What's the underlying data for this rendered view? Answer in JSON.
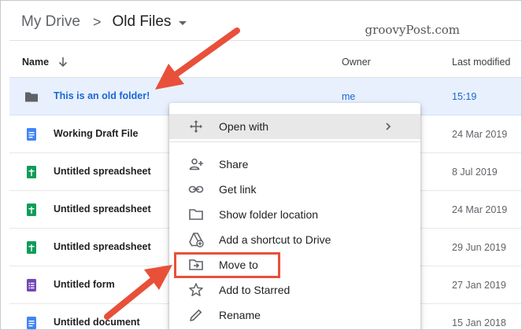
{
  "breadcrumb": {
    "root": "My Drive",
    "separator": ">",
    "current": "Old Files"
  },
  "watermark": "groovyPost.com",
  "columns": {
    "name": "Name",
    "owner": "Owner",
    "modified": "Last modified"
  },
  "rows": [
    {
      "name": "This is an old folder!",
      "owner": "me",
      "modified": "15:19",
      "icon": "folder-icon",
      "selected": true
    },
    {
      "name": "Working Draft File",
      "owner": "",
      "modified": "24 Mar 2019",
      "icon": "docs-icon"
    },
    {
      "name": "Untitled spreadsheet",
      "owner": "",
      "modified": "8 Jul 2019",
      "icon": "sheets-icon"
    },
    {
      "name": "Untitled spreadsheet",
      "owner": "",
      "modified": "24 Mar 2019",
      "icon": "sheets-icon"
    },
    {
      "name": "Untitled spreadsheet",
      "owner": "",
      "modified": "29 Jun 2019",
      "icon": "sheets-icon"
    },
    {
      "name": "Untitled form",
      "owner": "",
      "modified": "27 Jan 2019",
      "icon": "forms-icon"
    },
    {
      "name": "Untitled document",
      "owner": "",
      "modified": "15 Jan 2018",
      "icon": "docs-icon"
    }
  ],
  "context_menu": {
    "items": [
      {
        "label": "Open with",
        "icon": "move-arrows-icon",
        "has_submenu": true
      },
      {
        "label": "Share",
        "icon": "add-person-icon"
      },
      {
        "label": "Get link",
        "icon": "link-icon"
      },
      {
        "label": "Show folder location",
        "icon": "folder-outline-icon"
      },
      {
        "label": "Add a shortcut to Drive",
        "icon": "drive-shortcut-icon"
      },
      {
        "label": "Move to",
        "icon": "move-to-folder-icon",
        "highlighted": true
      },
      {
        "label": "Add to Starred",
        "icon": "star-outline-icon"
      },
      {
        "label": "Rename",
        "icon": "pencil-icon"
      }
    ]
  },
  "colors": {
    "selected_row": "#e8f0fe",
    "selected_text": "#1967d2",
    "annotation": "#e8503a",
    "docs": "#4285f4",
    "sheets": "#0f9d58",
    "forms": "#7248b9"
  }
}
